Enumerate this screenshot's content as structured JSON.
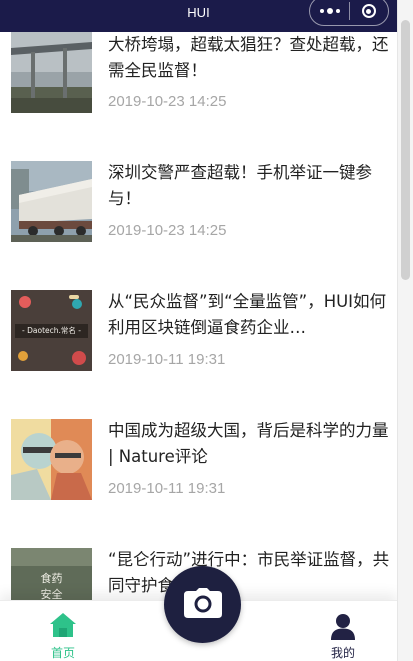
{
  "nav": {
    "title": "HUI"
  },
  "articles": [
    {
      "title": "大桥垮塌，超载太猖狂？查处超载，还需全民监督！",
      "date": "2019-10-23 14:25"
    },
    {
      "title": "深圳交警严查超载！手机举证一键参与！",
      "date": "2019-10-23 14:25"
    },
    {
      "title": "从“民众监督”到“全量监管”，HUI如何利用区块链倒逼食药企业…",
      "date": "2019-10-11 19:31",
      "thumb_text": "- Daotech.常名 -"
    },
    {
      "title": "中国成为超级大国，背后是科学的力量 | Nature评论",
      "date": "2019-10-11 19:31"
    },
    {
      "title": "“昆仑行动”进行中：市民举证监督，共同守护食药安全",
      "thumb_text_1": "食药",
      "thumb_text_2": "安全"
    }
  ],
  "tabbar": {
    "home_label": "首页",
    "mine_label": "我的",
    "active_color": "#2ec28a",
    "inactive_color": "#222244"
  }
}
